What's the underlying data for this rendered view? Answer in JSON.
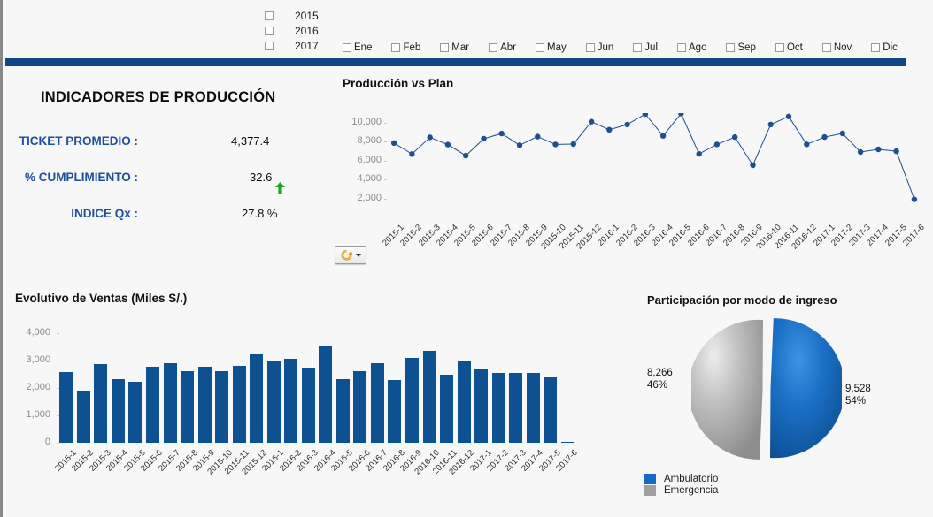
{
  "filters": {
    "years": [
      {
        "label": "2015",
        "checked": false
      },
      {
        "label": "2016",
        "checked": false
      },
      {
        "label": "2017",
        "checked": false
      }
    ],
    "months": [
      {
        "label": "Ene",
        "checked": false
      },
      {
        "label": "Feb",
        "checked": false
      },
      {
        "label": "Mar",
        "checked": false
      },
      {
        "label": "Abr",
        "checked": false
      },
      {
        "label": "May",
        "checked": false
      },
      {
        "label": "Jun",
        "checked": false
      },
      {
        "label": "Jul",
        "checked": false
      },
      {
        "label": "Ago",
        "checked": false
      },
      {
        "label": "Sep",
        "checked": false
      },
      {
        "label": "Oct",
        "checked": false
      },
      {
        "label": "Nov",
        "checked": false
      },
      {
        "label": "Dic",
        "checked": false
      }
    ]
  },
  "kpi": {
    "title": "INDICADORES DE PRODUCCIÓN",
    "rows": [
      {
        "label": "TICKET PROMEDIO :",
        "value": "4,377.4",
        "trend": "none"
      },
      {
        "label": "% CUMPLIMIENTO :",
        "value": "32.6",
        "trend": "up"
      },
      {
        "label": "INDICE Qx :",
        "value": "27.8 %",
        "trend": "none"
      }
    ],
    "label_color": "#1f4e9c",
    "trend_up_color": "#16a81c"
  },
  "toolbar": {
    "refresh_label": "refresh",
    "refresh_icon": "circular-arrow-icon"
  },
  "chart_data": [
    {
      "id": "produccion-vs-plan",
      "type": "line",
      "title": "Producción vs Plan",
      "xlabel": "",
      "ylabel": "",
      "ylim": [
        0,
        11000
      ],
      "yticks": [
        2000,
        4000,
        6000,
        8000,
        10000
      ],
      "ytick_labels": [
        "2,000",
        "4,000",
        "6,000",
        "8,000",
        "10,000"
      ],
      "grid": false,
      "legend": "none",
      "series_color": "#1f4f8c",
      "categories": [
        "2015-1",
        "2015-2",
        "2015-3",
        "2015-4",
        "2015-5",
        "2015-6",
        "2015-7",
        "2015-8",
        "2015-9",
        "2015-10",
        "2015-11",
        "2015-12",
        "2016-1",
        "2016-2",
        "2016-3",
        "2016-4",
        "2016-5",
        "2016-6",
        "2016-7",
        "2016-8",
        "2016-9",
        "2016-10",
        "2016-11",
        "2016-12",
        "2017-1",
        "2017-2",
        "2017-3",
        "2017-4",
        "2017-5",
        "2017-6"
      ],
      "series": [
        {
          "name": "Producción",
          "values": [
            7850,
            6680,
            8450,
            7680,
            6520,
            8300,
            8850,
            7620,
            8520,
            7700,
            7740,
            10100,
            9250,
            9800,
            10900,
            8600,
            10950,
            6700,
            7700,
            8470,
            5500,
            9800,
            10650,
            7700,
            8470,
            8860,
            6900,
            7180,
            6980,
            1900
          ]
        }
      ]
    },
    {
      "id": "evolutivo-de-ventas",
      "type": "bar",
      "title": "Evolutivo de Ventas (Miles S/.)",
      "xlabel": "",
      "ylabel": "",
      "ylim": [
        0,
        4300
      ],
      "yticks": [
        0,
        1000,
        2000,
        3000,
        4000
      ],
      "ytick_labels": [
        "0",
        "1,000",
        "2,000",
        "3,000",
        "4,000"
      ],
      "grid": false,
      "legend": "none",
      "bar_color": "#0d5193",
      "categories": [
        "2015-1",
        "2015-2",
        "2015-3",
        "2015-4",
        "2015-5",
        "2015-6",
        "2015-7",
        "2015-8",
        "2015-9",
        "2015-10",
        "2015-11",
        "2015-12",
        "2016-1",
        "2016-2",
        "2016-3",
        "2016-4",
        "2016-5",
        "2016-6",
        "2016-7",
        "2016-8",
        "2016-9",
        "2016-10",
        "2016-11",
        "2016-12",
        "2017-1",
        "2017-2",
        "2017-3",
        "2017-4",
        "2017-5",
        "2017-6"
      ],
      "values": [
        2590,
        1900,
        2870,
        2330,
        2240,
        2780,
        2900,
        2620,
        2780,
        2620,
        2810,
        3250,
        3010,
        3060,
        2760,
        3570,
        2330,
        2630,
        2920,
        2300,
        3110,
        3370,
        2490,
        2970,
        2690,
        2570,
        2560,
        2560,
        2410,
        40
      ]
    },
    {
      "id": "participacion-por-modo-de-ingreso",
      "type": "pie",
      "title": "Participación por modo de ingreso",
      "legend": "bottom-left",
      "labels": [
        "Ambulatorio",
        "Emergencia"
      ],
      "values": [
        9528,
        8266
      ],
      "percents": [
        "54%",
        "46%"
      ],
      "value_labels": [
        "9,528",
        "8,266"
      ],
      "colors": [
        "#1569c7",
        "#a0a0a0"
      ]
    }
  ],
  "colors": {
    "header_bar": "#0d4785",
    "page_background": "#f7f7f7"
  }
}
